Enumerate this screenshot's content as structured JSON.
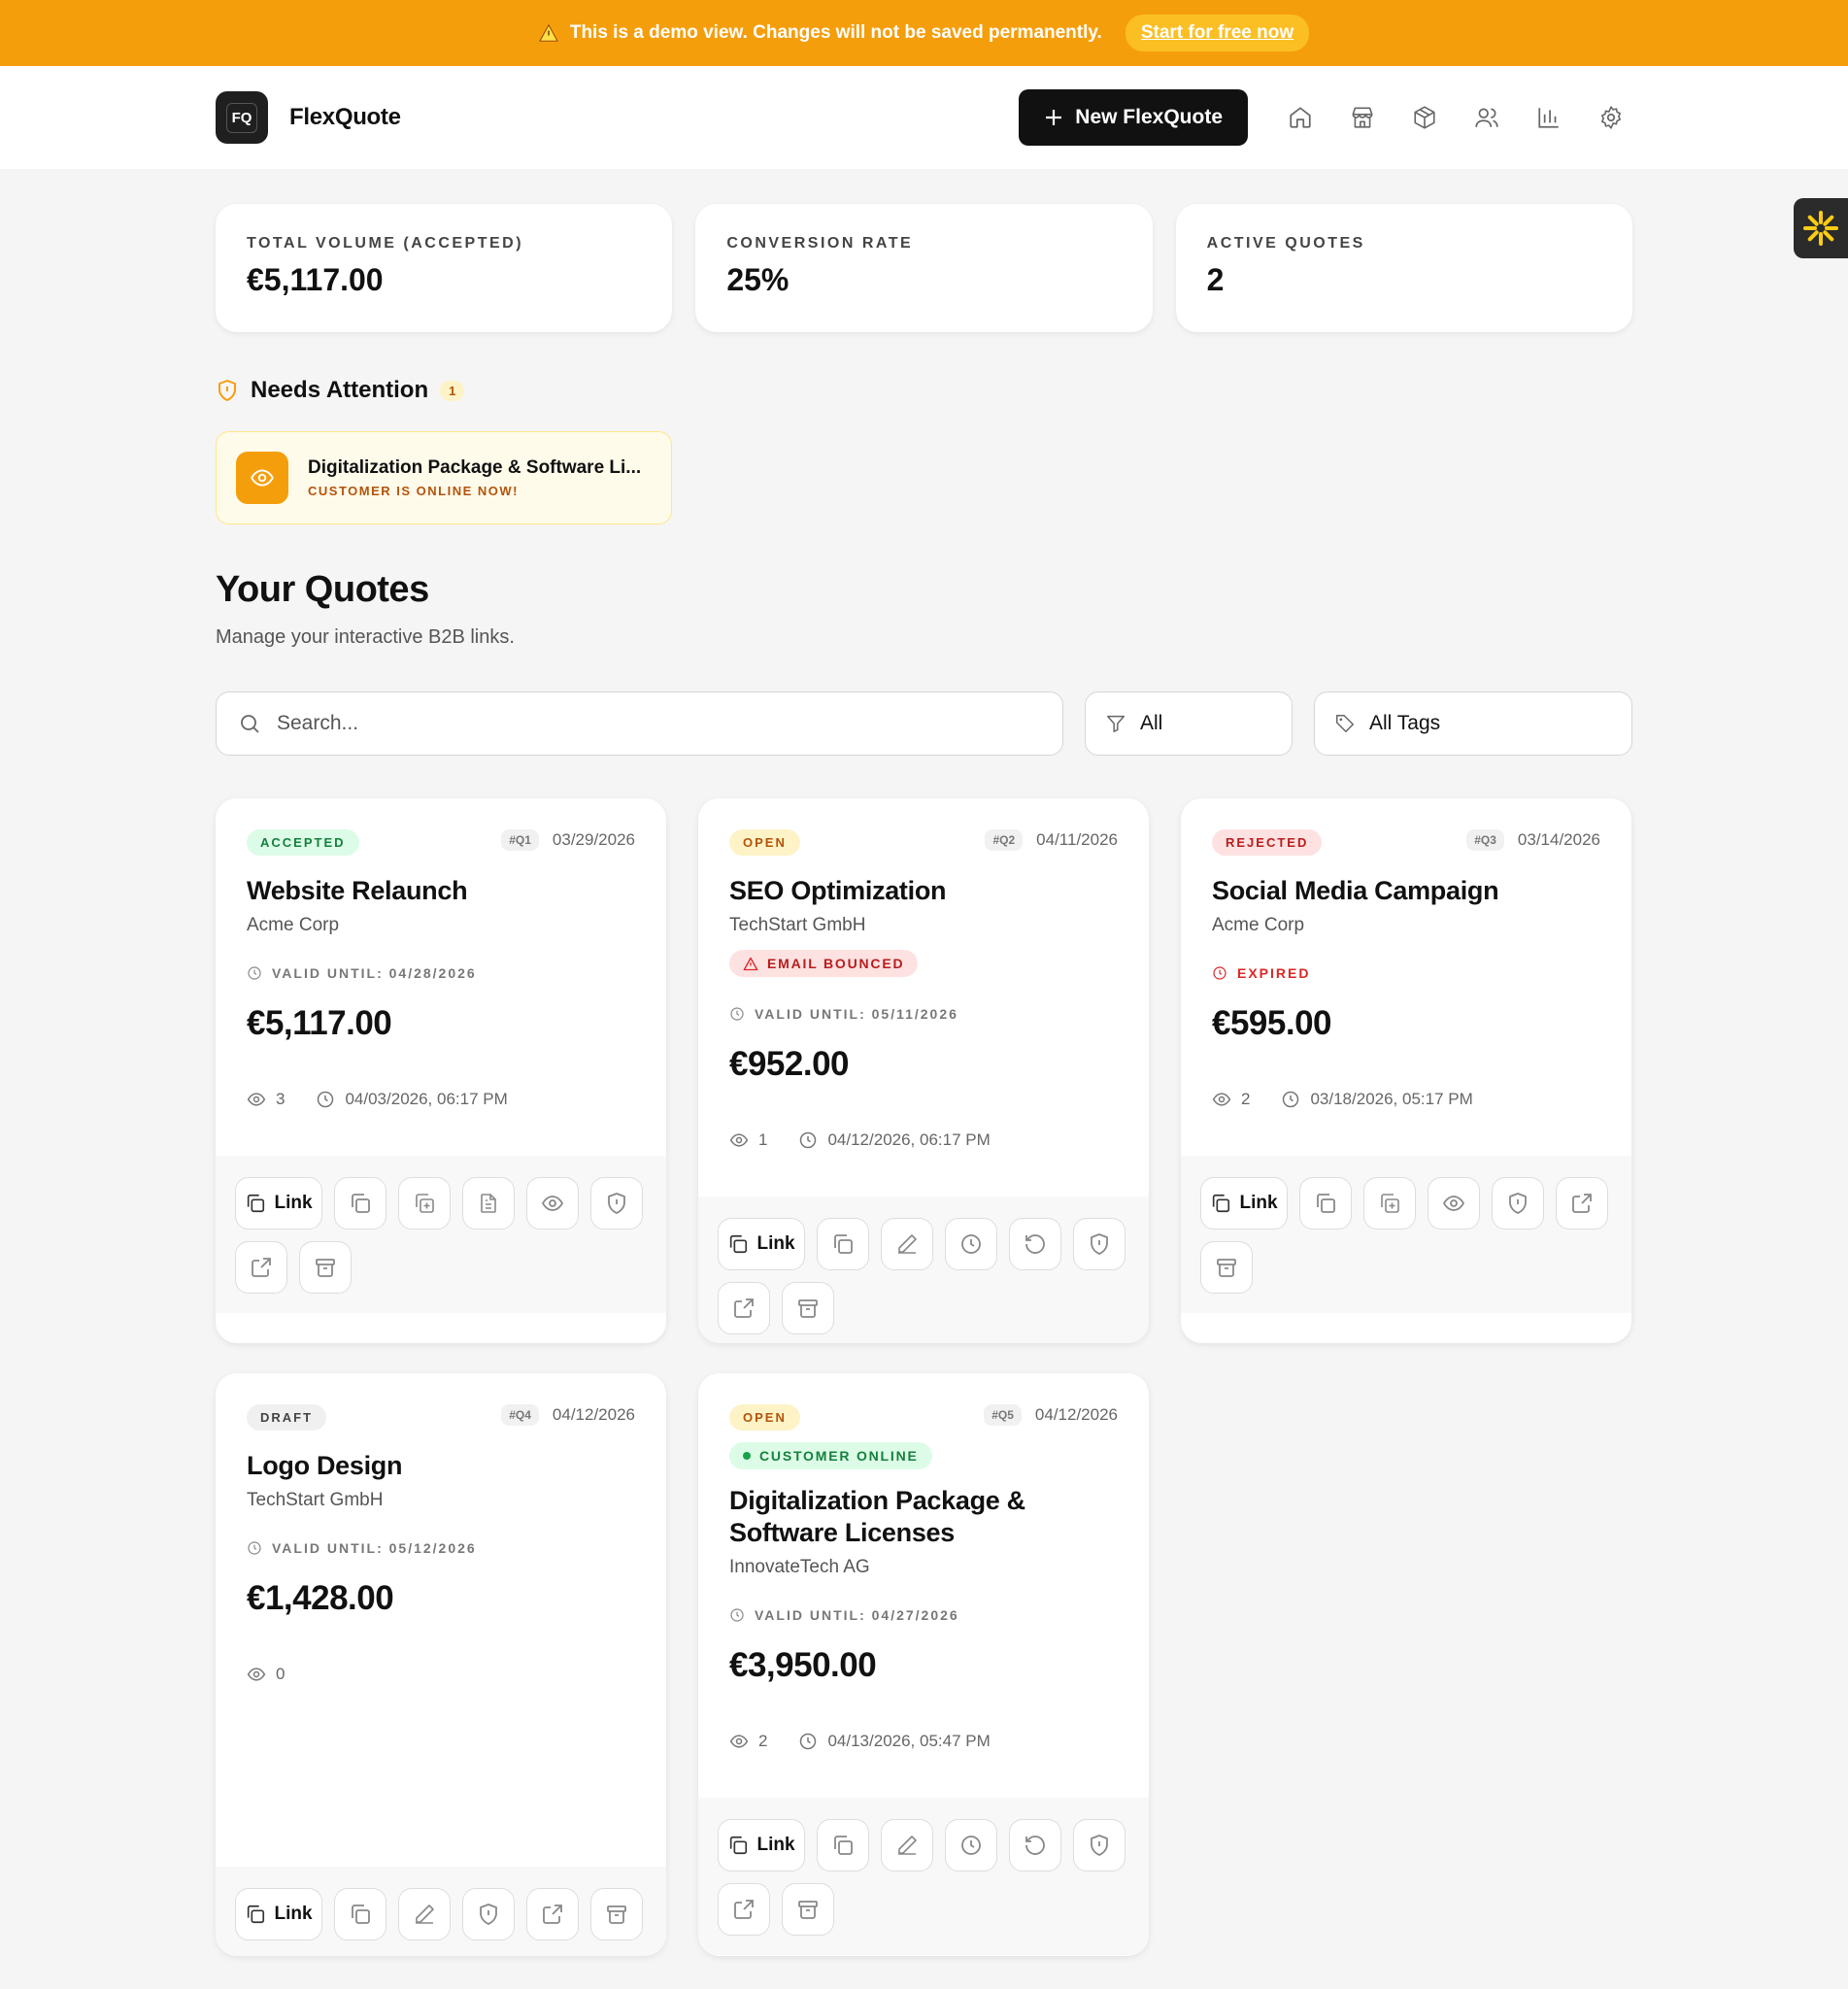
{
  "banner": {
    "text": "This is a demo view. Changes will not be saved permanently.",
    "cta": "Start for free now"
  },
  "header": {
    "logo_text": "FQ",
    "app_name": "FlexQuote",
    "new_button": "New FlexQuote",
    "nav_icons": [
      "home-icon",
      "store-icon",
      "box-icon",
      "users-icon",
      "chart-icon",
      "gear-icon"
    ]
  },
  "stats": [
    {
      "label": "TOTAL VOLUME (ACCEPTED)",
      "value": "€5,117.00"
    },
    {
      "label": "CONVERSION RATE",
      "value": "25%"
    },
    {
      "label": "ACTIVE QUOTES",
      "value": "2"
    }
  ],
  "attention": {
    "title": "Needs Attention",
    "count": "1",
    "item": {
      "title": "Digitalization Package & Software Li...",
      "subtitle": "CUSTOMER IS ONLINE NOW!"
    }
  },
  "quotes_section": {
    "title": "Your Quotes",
    "subtitle": "Manage your interactive B2B links."
  },
  "filters": {
    "search_placeholder": "Search...",
    "status": "All",
    "tags": "All Tags"
  },
  "quotes": [
    {
      "status": "ACCEPTED",
      "number": "#Q1",
      "date": "03/29/2026",
      "title": "Website Relaunch",
      "client": "Acme Corp",
      "valid": "VALID UNTIL: 04/28/2026",
      "price": "€5,117.00",
      "views": "3",
      "last_viewed": "04/03/2026, 06:17 PM",
      "link_label": "Link"
    },
    {
      "status": "OPEN",
      "number": "#Q2",
      "date": "04/11/2026",
      "title": "SEO Optimization",
      "client": "TechStart GmbH",
      "flag": "EMAIL BOUNCED",
      "valid": "VALID UNTIL: 05/11/2026",
      "price": "€952.00",
      "views": "1",
      "last_viewed": "04/12/2026, 06:17 PM",
      "link_label": "Link"
    },
    {
      "status": "REJECTED",
      "number": "#Q3",
      "date": "03/14/2026",
      "title": "Social Media Campaign",
      "client": "Acme Corp",
      "valid": "EXPIRED",
      "price": "€595.00",
      "views": "2",
      "last_viewed": "03/18/2026, 05:17 PM",
      "link_label": "Link"
    },
    {
      "status": "DRAFT",
      "number": "#Q4",
      "date": "04/12/2026",
      "title": "Logo Design",
      "client": "TechStart GmbH",
      "valid": "VALID UNTIL: 05/12/2026",
      "price": "€1,428.00",
      "views": "0",
      "link_label": "Link"
    },
    {
      "status": "OPEN",
      "number": "#Q5",
      "date": "04/12/2026",
      "flag": "CUSTOMER ONLINE",
      "title": "Digitalization Package & Software Licenses",
      "client": "InnovateTech AG",
      "valid": "VALID UNTIL: 04/27/2026",
      "price": "€3,950.00",
      "views": "2",
      "last_viewed": "04/13/2026, 05:47 PM",
      "link_label": "Link"
    }
  ]
}
